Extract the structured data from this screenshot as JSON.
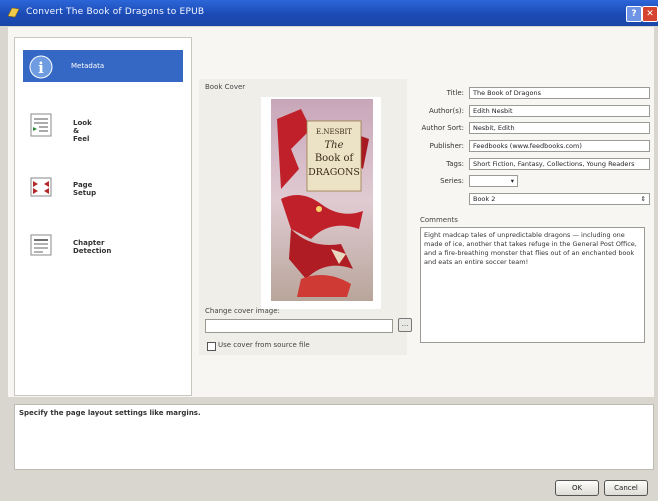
{
  "window": {
    "title": "Convert The Book of Dragons to EPUB",
    "help": "?",
    "close": "✕"
  },
  "sidebar": {
    "items": [
      {
        "label": "Metadata",
        "icon": "info-icon"
      },
      {
        "label": "Look\n&\nFeel",
        "icon": "look-feel-icon"
      },
      {
        "label": "Page\nSetup",
        "icon": "page-setup-icon"
      },
      {
        "label": "Chapter\nDetection",
        "icon": "chapter-icon"
      }
    ],
    "selected": 0
  },
  "cover": {
    "label": "Book Cover",
    "book_author": "E.NESBIT",
    "book_title_1": "The",
    "book_title_2": "Book of",
    "book_title_3": "DRAGONS",
    "change_label": "Change cover image:",
    "path_value": "",
    "browse": "...",
    "use_source_label": "Use cover from source file"
  },
  "metadata": {
    "title_label": "Title:",
    "title_value": "The Book of Dragons",
    "authors_label": "Author(s):",
    "authors_value": "Edith Nesbit",
    "author_sort_label": "Author Sort:",
    "author_sort_value": "Nesbit, Edith",
    "publisher_label": "Publisher:",
    "publisher_value": "Feedbooks (www.feedbooks.com)",
    "tags_label": "Tags:",
    "tags_value": "Short Fiction, Fantasy, Collections, Young Readers",
    "series_label": "Series:",
    "series_value": "",
    "book_number": "Book 2",
    "comments_label": "Comments",
    "comments_text": "Eight madcap tales of unpredictable dragons — including one made of ice, another that takes refuge in the General Post Office, and a fire-breathing monster that flies out of an enchanted book and eats an entire soccer team!"
  },
  "help": {
    "text": "Specify the page layout settings like margins."
  },
  "buttons": {
    "ok": "OK",
    "cancel": "Cancel"
  },
  "colors": {
    "titlebar": "#1c4bb5",
    "selected": "#3568c4",
    "book_red": "#c0202a"
  }
}
